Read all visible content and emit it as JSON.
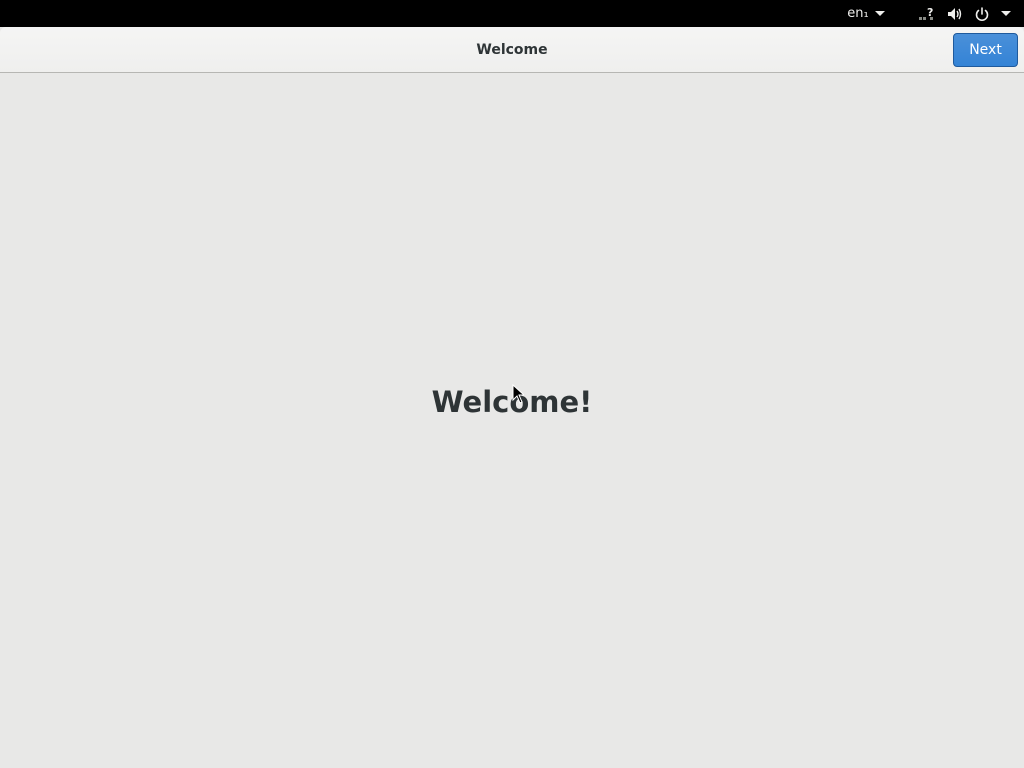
{
  "topbar": {
    "input_source": "en₁",
    "icons": [
      "network-unknown-icon",
      "volume-icon",
      "power-icon"
    ]
  },
  "header": {
    "title": "Welcome",
    "next_label": "Next"
  },
  "main": {
    "heading": "Welcome!"
  },
  "colors": {
    "accent": "#3483d6",
    "topbar": "#000000",
    "background": "#e8e8e7",
    "text": "#2e3436"
  }
}
